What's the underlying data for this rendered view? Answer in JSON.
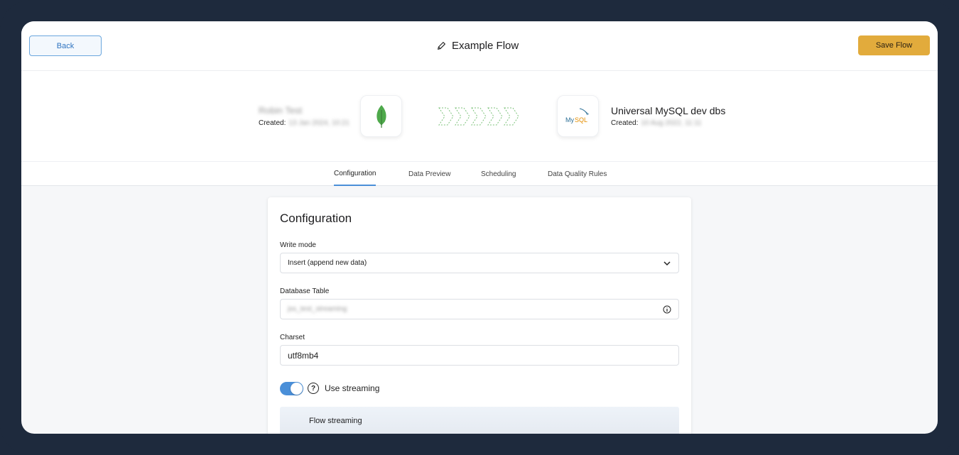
{
  "header": {
    "back_label": "Back",
    "title": "Example Flow",
    "save_label": "Save Flow"
  },
  "flow": {
    "source": {
      "name": "Robin Test",
      "created_label": "Created:",
      "created_value": "13 Jan 2024, 10:21",
      "icon": "mongodb-leaf-icon"
    },
    "destination": {
      "name": "Universal MySQL dev dbs",
      "created_label": "Created:",
      "created_value": "10 Aug 2022, 11:11",
      "icon": "mysql-logo-icon",
      "logo_text": "MySQL"
    }
  },
  "tabs": [
    {
      "label": "Configuration",
      "active": true
    },
    {
      "label": "Data Preview",
      "active": false
    },
    {
      "label": "Scheduling",
      "active": false
    },
    {
      "label": "Data Quality Rules",
      "active": false
    }
  ],
  "config": {
    "title": "Configuration",
    "write_mode": {
      "label": "Write mode",
      "value": "Insert (append new data)"
    },
    "database_table": {
      "label": "Database Table",
      "value": "jss_test_streaming"
    },
    "charset": {
      "label": "Charset",
      "value": "utf8mb4"
    },
    "streaming": {
      "label": "Use streaming",
      "enabled": true,
      "help": "?"
    },
    "flow_streaming_title": "Flow streaming"
  },
  "colors": {
    "accent": "#4a8fd8",
    "save": "#e2ab3c",
    "frame": "#1e2a3d"
  }
}
